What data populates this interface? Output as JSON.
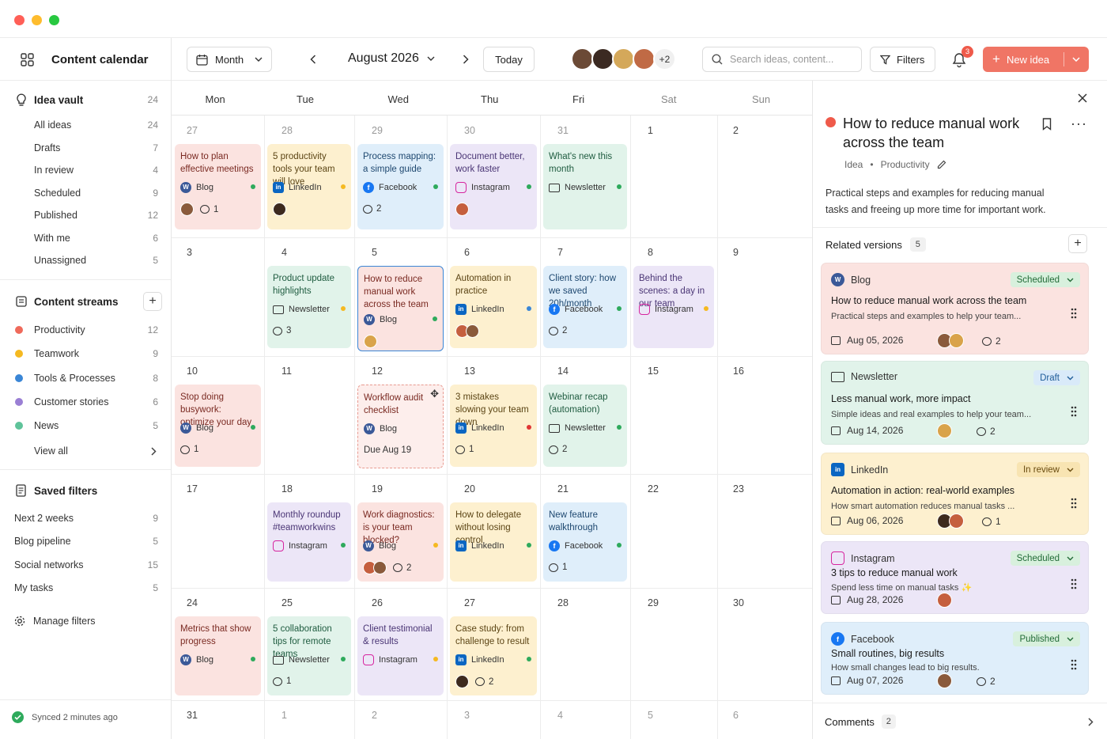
{
  "app": {
    "title": "Content calendar"
  },
  "sidebar": {
    "idea_vault": {
      "label": "Idea vault",
      "count": "24",
      "items": [
        {
          "label": "All ideas",
          "count": "24"
        },
        {
          "label": "Drafts",
          "count": "7"
        },
        {
          "label": "In review",
          "count": "4"
        },
        {
          "label": "Scheduled",
          "count": "9"
        },
        {
          "label": "Published",
          "count": "12"
        },
        {
          "label": "With me",
          "count": "6"
        },
        {
          "label": "Unassigned",
          "count": "5"
        }
      ]
    },
    "streams": {
      "label": "Content streams",
      "items": [
        {
          "label": "Productivity",
          "count": "12",
          "color": "#ef6a5b"
        },
        {
          "label": "Teamwork",
          "count": "9",
          "color": "#f5b921"
        },
        {
          "label": "Tools & Processes",
          "count": "8",
          "color": "#3a86d6"
        },
        {
          "label": "Customer stories",
          "count": "6",
          "color": "#9a7fd4"
        },
        {
          "label": "News",
          "count": "5",
          "color": "#5fc39a"
        }
      ],
      "view_all": "View all"
    },
    "saved_filters": {
      "label": "Saved filters",
      "items": [
        {
          "label": "Next 2 weeks",
          "count": "9"
        },
        {
          "label": "Blog pipeline",
          "count": "5"
        },
        {
          "label": "Social networks",
          "count": "15"
        },
        {
          "label": "My tasks",
          "count": "5"
        }
      ],
      "manage": "Manage filters"
    },
    "sync": "Synced 2 minutes ago"
  },
  "toolbar": {
    "view": "Month",
    "period": "August 2026",
    "today": "Today",
    "extra_users": "+2",
    "search_placeholder": "Search ideas, content...",
    "filters": "Filters",
    "notif_count": "3",
    "new_idea": "New idea"
  },
  "calendar": {
    "days": [
      "Mon",
      "Tue",
      "Wed",
      "Thu",
      "Fri",
      "Sat",
      "Sun"
    ],
    "weeks": [
      [
        "27",
        "28",
        "29",
        "30",
        "31",
        "1",
        "2"
      ],
      [
        "3",
        "4",
        "5",
        "6",
        "7",
        "8",
        "9"
      ],
      [
        "10",
        "11",
        "12",
        "13",
        "14",
        "15",
        "16"
      ],
      [
        "17",
        "18",
        "19",
        "20",
        "21",
        "22",
        "23"
      ],
      [
        "24",
        "25",
        "26",
        "27",
        "28",
        "29",
        "30"
      ],
      [
        "31",
        "1",
        "2",
        "3",
        "4",
        "5",
        "6"
      ]
    ],
    "cards": [
      {
        "w": 0,
        "d": 0,
        "title": "How to plan effective meetings",
        "channel": "Blog",
        "ch": "wp",
        "color": "red",
        "dot": "#2eaa5c",
        "avatars": 1,
        "count": "1",
        "h": 108
      },
      {
        "w": 0,
        "d": 1,
        "title": "5 productivity tools your team will love",
        "channel": "LinkedIn",
        "ch": "li",
        "color": "yel",
        "dot": "#f5b921",
        "avatars": 1,
        "count": "",
        "h": 108
      },
      {
        "w": 0,
        "d": 2,
        "title": "Process mapping: a simple guide",
        "channel": "Facebook",
        "ch": "fb",
        "color": "blu",
        "dot": "#2eaa5c",
        "avatars": 0,
        "count": "2",
        "h": 108
      },
      {
        "w": 0,
        "d": 3,
        "title": "Document better, work faster",
        "channel": "Instagram",
        "ch": "ig",
        "color": "pur",
        "dot": "#2eaa5c",
        "avatars": 1,
        "count": "",
        "h": 108
      },
      {
        "w": 0,
        "d": 4,
        "title": "What's new this month",
        "channel": "Newsletter",
        "ch": "nl",
        "color": "grn",
        "dot": "#2eaa5c",
        "avatars": 0,
        "count": "",
        "h": 108
      },
      {
        "w": 1,
        "d": 1,
        "title": "Product update highlights",
        "channel": "Newsletter",
        "ch": "nl",
        "color": "grn",
        "dot": "#f5b921",
        "avatars": 0,
        "count": "3",
        "h": 104
      },
      {
        "w": 1,
        "d": 2,
        "title": "How to reduce manual work across the team",
        "channel": "Blog",
        "ch": "wp",
        "color": "red",
        "dot": "#2eaa5c",
        "avatars": 1,
        "count": "",
        "h": 108,
        "selected": true
      },
      {
        "w": 1,
        "d": 3,
        "title": "Automation in practice",
        "channel": "LinkedIn",
        "ch": "li",
        "color": "yel",
        "dot": "#3a86d6",
        "avatars": 2,
        "count": "",
        "h": 104
      },
      {
        "w": 1,
        "d": 4,
        "title": "Client story: how we saved 20h/month",
        "channel": "Facebook",
        "ch": "fb",
        "color": "blu",
        "dot": "#2eaa5c",
        "avatars": 0,
        "count": "2",
        "h": 104
      },
      {
        "w": 1,
        "d": 5,
        "title": "Behind the scenes: a day in our team",
        "channel": "Instagram",
        "ch": "ig",
        "color": "pur",
        "dot": "#f5b921",
        "avatars": 0,
        "count": "",
        "h": 104
      },
      {
        "w": 2,
        "d": 0,
        "title": "Stop doing busywork: optimize your day",
        "channel": "Blog",
        "ch": "wp",
        "color": "red",
        "dot": "#2eaa5c",
        "avatars": 0,
        "count": "1",
        "h": 104
      },
      {
        "w": 2,
        "d": 2,
        "title": "Workflow audit checklist",
        "channel": "Blog",
        "ch": "wp",
        "color": "red",
        "dot": "",
        "avatars": 0,
        "count": "",
        "h": 106,
        "dashed": true,
        "due": "Due Aug 19"
      },
      {
        "w": 2,
        "d": 3,
        "title": "3 mistakes slowing your team down",
        "channel": "LinkedIn",
        "ch": "li",
        "color": "yel",
        "dot": "#e03535",
        "avatars": 0,
        "count": "1",
        "h": 104
      },
      {
        "w": 2,
        "d": 4,
        "title": "Webinar recap (automation)",
        "channel": "Newsletter",
        "ch": "nl",
        "color": "grn",
        "dot": "#2eaa5c",
        "avatars": 0,
        "count": "2",
        "h": 104
      },
      {
        "w": 3,
        "d": 1,
        "title": "Monthly roundup #teamworkwins",
        "channel": "Instagram",
        "ch": "ig",
        "color": "pur",
        "dot": "#2eaa5c",
        "avatars": 0,
        "count": "",
        "h": 100
      },
      {
        "w": 3,
        "d": 2,
        "title": "Work diagnostics: is your team blocked?",
        "channel": "Blog",
        "ch": "wp",
        "color": "red",
        "dot": "#f5b921",
        "avatars": 2,
        "count": "2",
        "h": 100
      },
      {
        "w": 3,
        "d": 3,
        "title": "How to delegate without losing control",
        "channel": "LinkedIn",
        "ch": "li",
        "color": "yel",
        "dot": "#2eaa5c",
        "avatars": 0,
        "count": "",
        "h": 100
      },
      {
        "w": 3,
        "d": 4,
        "title": "New feature walkthrough",
        "channel": "Facebook",
        "ch": "fb",
        "color": "blu",
        "dot": "#2eaa5c",
        "avatars": 0,
        "count": "1",
        "h": 100
      },
      {
        "w": 4,
        "d": 0,
        "title": "Metrics that show progress",
        "channel": "Blog",
        "ch": "wp",
        "color": "red",
        "dot": "#2eaa5c",
        "avatars": 0,
        "count": "",
        "h": 100
      },
      {
        "w": 4,
        "d": 1,
        "title": "5 collaboration tips for remote teams",
        "channel": "Newsletter",
        "ch": "nl",
        "color": "grn",
        "dot": "#2eaa5c",
        "avatars": 0,
        "count": "1",
        "h": 100
      },
      {
        "w": 4,
        "d": 2,
        "title": "Client testimonial & results",
        "channel": "Instagram",
        "ch": "ig",
        "color": "pur",
        "dot": "#f5b921",
        "avatars": 0,
        "count": "",
        "h": 100
      },
      {
        "w": 4,
        "d": 3,
        "title": "Case study: from challenge to result",
        "channel": "LinkedIn",
        "ch": "li",
        "color": "yel",
        "dot": "#2eaa5c",
        "avatars": 1,
        "count": "2",
        "h": 100
      }
    ]
  },
  "panel": {
    "title": "How to reduce manual work across the team",
    "type": "Idea",
    "stream": "Productivity",
    "description": "Practical steps and examples for reducing manual tasks and freeing up more time for important work.",
    "related_label": "Related versions",
    "related_count": "5",
    "versions": [
      {
        "channel": "Blog",
        "ch": "wp",
        "status": "Scheduled",
        "title": "How to reduce manual work across the team",
        "desc": "Practical steps and examples to help your team...",
        "date": "Aug 05, 2026",
        "comments": "2",
        "avatars": 2,
        "bg": "#fbe3e0",
        "pill_bg": "#d8f0dd",
        "pill_fg": "#226b37"
      },
      {
        "channel": "Newsletter",
        "ch": "nl",
        "status": "Draft",
        "title": "Less manual work, more impact",
        "desc": "Simple ideas and real examples to help your team...",
        "date": "Aug 14, 2026",
        "comments": "2",
        "avatars": 1,
        "bg": "#e1f3ea",
        "pill_bg": "#d9eaf9",
        "pill_fg": "#1f5d99"
      },
      {
        "channel": "LinkedIn",
        "ch": "li",
        "status": "In review",
        "title": "Automation in action: real-world examples",
        "desc": "How smart automation reduces manual tasks ...",
        "date": "Aug 06, 2026",
        "comments": "1",
        "avatars": 2,
        "bg": "#fdf0cf",
        "pill_bg": "#f8e4b2",
        "pill_fg": "#6a4c10"
      },
      {
        "channel": "Instagram",
        "ch": "ig",
        "status": "Scheduled",
        "title": "3 tips to reduce manual work",
        "desc": "Spend less time on manual tasks ✨",
        "date": "Aug 28, 2026",
        "comments": "",
        "avatars": 1,
        "bg": "#ece6f7",
        "pill_bg": "#d8f0dd",
        "pill_fg": "#226b37"
      },
      {
        "channel": "Facebook",
        "ch": "fb",
        "status": "Published",
        "title": "Small routines, big results",
        "desc": "How small changes lead to big results.",
        "date": "Aug 07, 2026",
        "comments": "2",
        "avatars": 1,
        "bg": "#dfeefa",
        "pill_bg": "#d8f0dd",
        "pill_fg": "#226b37"
      }
    ],
    "comments_label": "Comments",
    "comments_count": "2"
  }
}
